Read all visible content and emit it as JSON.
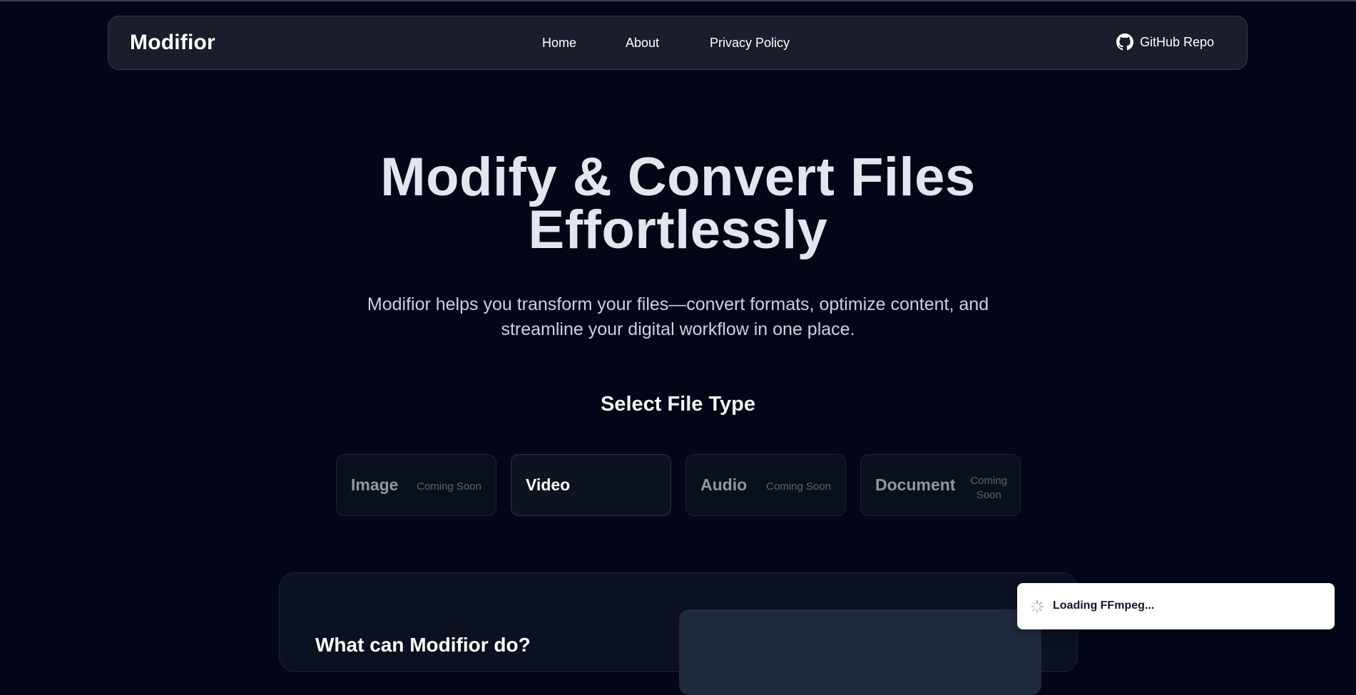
{
  "navbar": {
    "brand": "Modifior",
    "links": [
      "Home",
      "About",
      "Privacy Policy"
    ],
    "github_label": "GitHub Repo",
    "github_icon": "github-icon"
  },
  "hero": {
    "title_line1": "Modify & Convert Files",
    "title_line2": "Effortlessly",
    "subtitle_line1": "Modifior helps you transform your files—convert formats, optimize content, and",
    "subtitle_line2": "streamline your digital workflow in one place."
  },
  "file_type": {
    "heading": "Select File Type",
    "options": [
      {
        "label": "Image",
        "badge": "Coming Soon",
        "active": false
      },
      {
        "label": "Video",
        "badge": "",
        "active": true
      },
      {
        "label": "Audio",
        "badge": "Coming Soon",
        "active": false
      },
      {
        "label": "Document",
        "badge_line1": "Coming",
        "badge_line2": "Soon",
        "active": false
      }
    ]
  },
  "features": {
    "heading": "What can Modifior do?"
  },
  "toast": {
    "message": "Loading FFmpeg...",
    "icon": "spinner-icon"
  },
  "colors": {
    "background": "#020617",
    "navbar": "#1a1e2c",
    "card": "#0a0f1d",
    "toast": "#ffffff"
  }
}
